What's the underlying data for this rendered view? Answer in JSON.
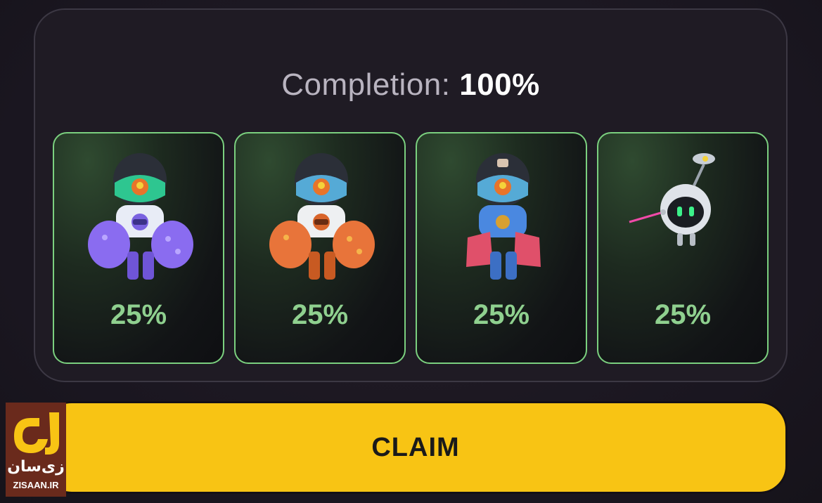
{
  "completion": {
    "label": "Completion:",
    "value": "100%"
  },
  "cards": [
    {
      "percent": "25%",
      "icon": "purple-mech-robot-icon",
      "color": "#8a6cf0"
    },
    {
      "percent": "25%",
      "icon": "orange-mech-robot-icon",
      "color": "#e8743a"
    },
    {
      "percent": "25%",
      "icon": "blue-red-mech-robot-icon",
      "color": "#4a88e0"
    },
    {
      "percent": "25%",
      "icon": "flying-drone-robot-icon",
      "color": "#d8dde4"
    }
  ],
  "claim_button": {
    "label": "CLAIM"
  },
  "watermark": {
    "persian": "زی‌سان",
    "latin": "ZISAAN.IR"
  },
  "colors": {
    "accent_green": "#7bd07f",
    "claim_yellow": "#f8c414",
    "background": "#1c1820"
  }
}
